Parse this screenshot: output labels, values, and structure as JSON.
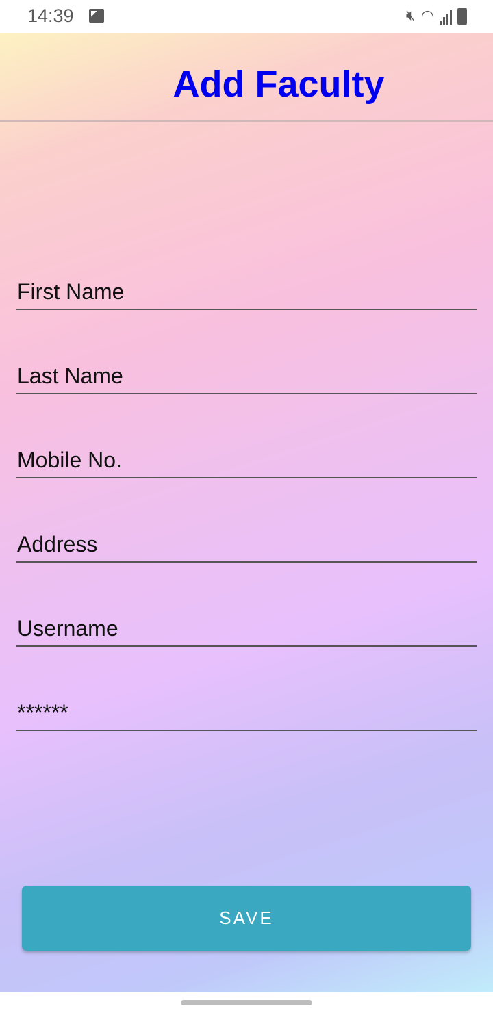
{
  "status_bar": {
    "time": "14:39",
    "icons": [
      "image-icon",
      "mute-icon",
      "wifi-icon",
      "signal-icon",
      "battery-icon"
    ]
  },
  "header": {
    "title": "Add Faculty"
  },
  "form": {
    "fields": [
      {
        "placeholder": "First Name"
      },
      {
        "placeholder": "Last Name"
      },
      {
        "placeholder": "Mobile No."
      },
      {
        "placeholder": "Address"
      },
      {
        "placeholder": "Username"
      },
      {
        "placeholder": "******"
      }
    ]
  },
  "save_label": "SAVE",
  "colors": {
    "title": "#0000ee",
    "button": "#3aa8c1"
  }
}
